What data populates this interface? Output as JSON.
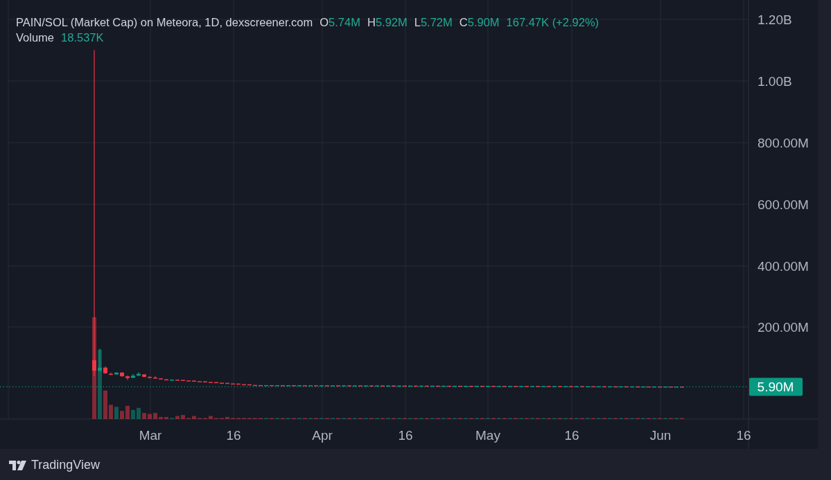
{
  "legend": {
    "title": "PAIN/SOL (Market Cap) on Meteora, 1D, dexscreener.com",
    "values": [
      {
        "label": "O",
        "value": "5.74M"
      },
      {
        "label": "H",
        "value": "5.92M"
      },
      {
        "label": "L",
        "value": "5.72M"
      },
      {
        "label": "C",
        "value": "5.90M"
      }
    ],
    "change": "167.47K (+2.92%)",
    "volume_label": "Volume",
    "volume_value": "18.537K"
  },
  "chart": {
    "kind": "candlestick",
    "price_axis": [
      "1.20B",
      "1.00B",
      "800.00M",
      "600.00M",
      "400.00M",
      "200.00M"
    ],
    "time_axis": [
      "Mar",
      "16",
      "Apr",
      "16",
      "May",
      "16",
      "Jun",
      "16"
    ],
    "last_price": "5.90M"
  },
  "footer": {
    "brand": "TradingView"
  }
}
